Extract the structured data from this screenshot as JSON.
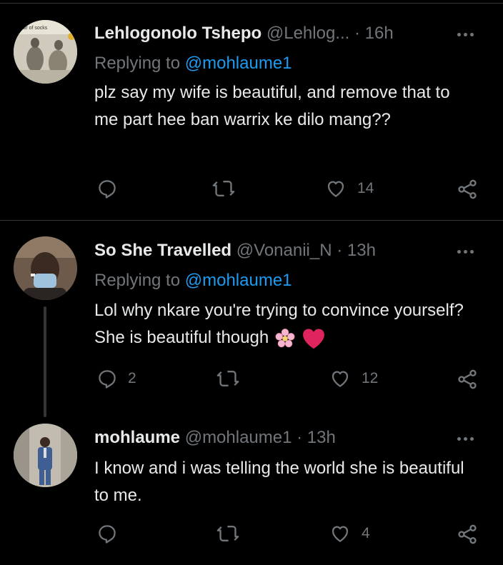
{
  "tweets": [
    {
      "name": "Lehlogonolo Tshepo",
      "handle": "@Lehlog...",
      "time": "· 16h",
      "replying_prefix": "Replying to ",
      "replying_handle": "@mohlaume1",
      "text": "plz say my wife is beautiful, and remove that to me part hee ban warrix ke dilo mang??",
      "replies": "",
      "retweets": "",
      "likes": "14",
      "avatar_caption": "pair of socks"
    },
    {
      "name": "So She Travelled",
      "handle": "@Vonanii_N",
      "time": "· 13h",
      "replying_prefix": "Replying to ",
      "replying_handle": "@mohlaume1",
      "text": "Lol why nkare you're trying to convince yourself? She is beautiful though",
      "replies": "2",
      "retweets": "",
      "likes": "12"
    },
    {
      "name": "mohlaume",
      "handle": "@mohlaume1",
      "time": "· 13h",
      "text": "I know and i was telling the world she is beautiful to me.",
      "replies": "",
      "retweets": "",
      "likes": "4"
    }
  ],
  "icons": {
    "more": "more-horizontal-icon",
    "reply": "reply-icon",
    "retweet": "retweet-icon",
    "like": "heart-icon",
    "share": "share-icon"
  },
  "colors": {
    "background": "#000000",
    "text": "#e7e9ea",
    "muted": "#71767b",
    "link": "#1d9bf0",
    "divider": "#2f3336",
    "heart_emoji": "#e0245e"
  }
}
